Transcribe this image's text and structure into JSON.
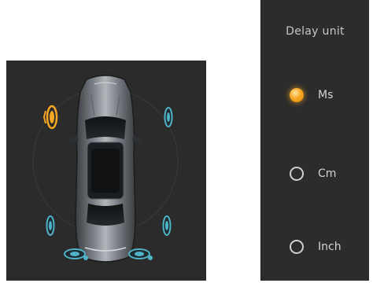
{
  "speaker_layout": {
    "selected_speaker": "front-left",
    "colors": {
      "active": "#f5a623",
      "inactive": "#4fb3c8",
      "background": "#2b2b2b"
    }
  },
  "delay_unit": {
    "title": "Delay unit",
    "options": [
      {
        "label": "Ms",
        "selected": true
      },
      {
        "label": "Cm",
        "selected": false
      },
      {
        "label": "Inch",
        "selected": false
      }
    ]
  }
}
